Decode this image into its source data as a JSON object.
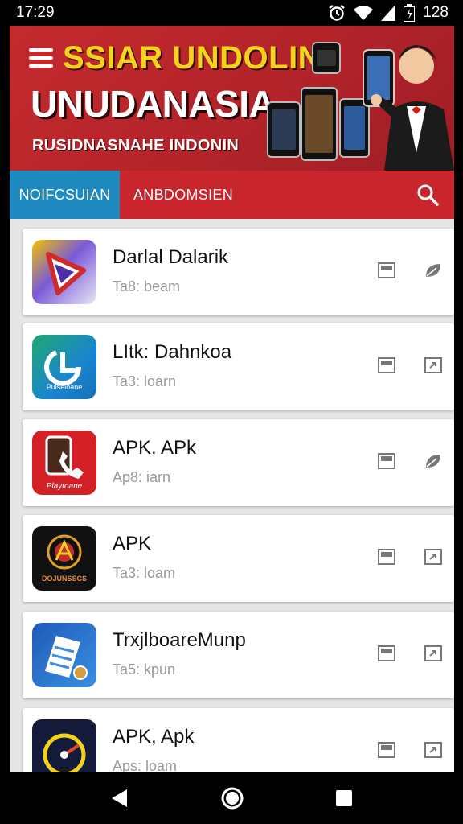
{
  "status_bar": {
    "time": "17:29",
    "battery": "128",
    "icons": [
      "alarm-icon",
      "wifi-icon",
      "signal-icon",
      "battery-icon"
    ]
  },
  "banner": {
    "title": "SSIAR UNDOLIN",
    "subtitle": "UNUDANASIA",
    "tagline": "RUSIDNASNAHE INDONIN",
    "colors": {
      "background": "#c42a2e",
      "title": "#f5d31c"
    }
  },
  "tabs": {
    "active": "NOIFCSUIAN",
    "second": "ANBDOMSIEN",
    "colors": {
      "active": "#1f8ac0",
      "bar": "#c8262c"
    }
  },
  "apps": [
    {
      "name": "Darlal Dalarik",
      "subtitle": "Ta8: beam",
      "icon": "play-triangle-icon",
      "action1": "save-icon",
      "action2": "leaf-icon"
    },
    {
      "name": "LItk: Dahnkoa",
      "subtitle": "Ta3: loarn",
      "icon": "cloud-download-icon",
      "action1": "save-icon",
      "action2": "external-icon"
    },
    {
      "name": "APK. APk",
      "subtitle": "Ap8: iarn",
      "icon": "phone-icon",
      "action1": "save-icon",
      "action2": "leaf-icon"
    },
    {
      "name": "APK",
      "subtitle": "Ta3: loam",
      "icon": "emblem-icon",
      "action1": "save-icon",
      "action2": "external-icon"
    },
    {
      "name": "TrxjlboareMunp",
      "subtitle": "Ta5: kpun",
      "icon": "document-icon",
      "action1": "save-icon",
      "action2": "external-icon"
    },
    {
      "name": "APK, Apk",
      "subtitle": "Aps: loam",
      "icon": "dial-icon",
      "action1": "save-icon",
      "action2": "external-icon"
    }
  ],
  "app_icon_labels": {
    "cloud": "Pulseloane",
    "phone": "Playtoane",
    "emblem": "DOJUNSSCS"
  },
  "navbar": {
    "icons": [
      "back-icon",
      "home-icon",
      "recents-icon"
    ]
  }
}
